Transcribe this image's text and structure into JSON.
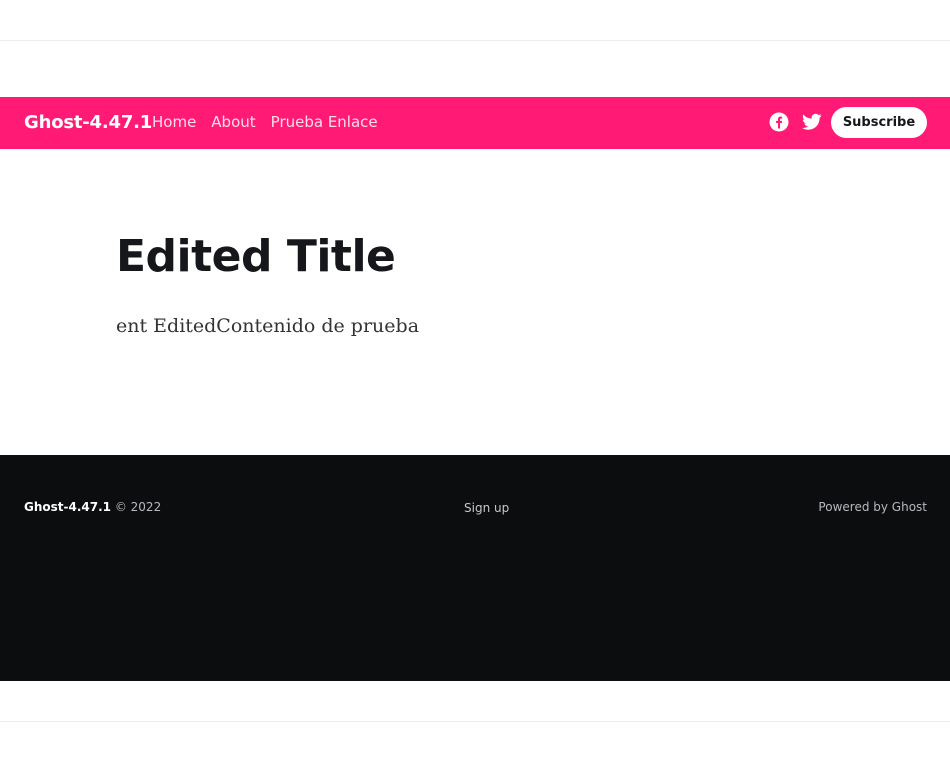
{
  "header": {
    "brand": "Ghost-4.47.1",
    "nav": [
      {
        "label": "Home"
      },
      {
        "label": "About"
      },
      {
        "label": "Prueba Enlace"
      }
    ],
    "social_icons": [
      "facebook-icon",
      "twitter-icon"
    ],
    "subscribe_label": "Subscribe",
    "accent_color": "#ff1a75"
  },
  "post": {
    "title": "Edited Title",
    "content": "ent EditedContenido de prueba"
  },
  "footer": {
    "brand": "Ghost-4.47.1",
    "copyright": "© 2022",
    "signup_label": "Sign up",
    "powered_by": "Powered by Ghost",
    "background_color": "#0c0d0f"
  }
}
